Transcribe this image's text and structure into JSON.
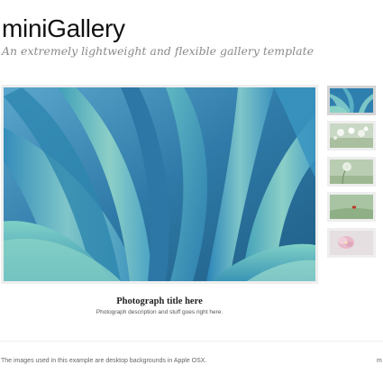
{
  "header": {
    "title": "miniGallery",
    "tagline": "An extremely lightweight and flexible gallery template"
  },
  "gallery": {
    "main_image": "agave-leaves-photo",
    "selected_index": 0,
    "thumbnails": [
      {
        "image": "agave-leaves-thumbnail",
        "selected": true
      },
      {
        "image": "white-flowers-thumbnail",
        "selected": false
      },
      {
        "image": "dandelion-thumbnail",
        "selected": false
      },
      {
        "image": "ladybug-thumbnail",
        "selected": false
      },
      {
        "image": "pink-flower-thumbnail",
        "selected": false
      }
    ],
    "caption": {
      "title": "Photograph title here",
      "description": "Photograph description and stuff goes right here."
    }
  },
  "footer": {
    "note": "The images used in this example are desktop backgrounds in Apple OSX.",
    "edge_text": "m"
  },
  "colors": {
    "accent_photo": "#3a8fbf",
    "thumb_border": "#eeeeee"
  }
}
